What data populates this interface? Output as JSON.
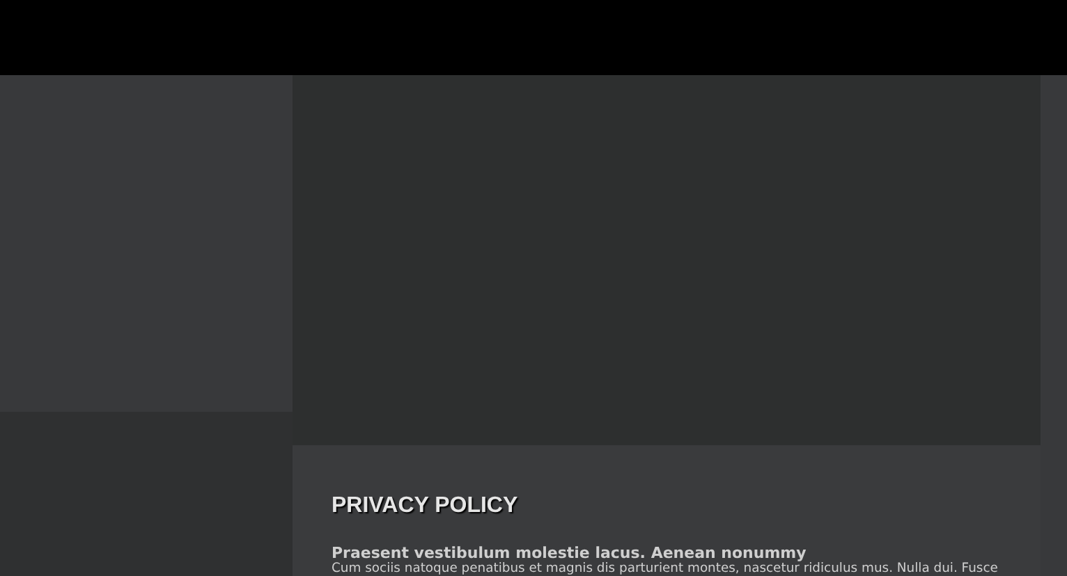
{
  "section": {
    "title": "PRIVACY POLICY",
    "subtitle": "Praesent vestibulum molestie lacus. Aenean nonummy",
    "paragraph": "Cum sociis natoque penatibus et magnis dis parturient montes, nascetur ridiculus mus. Nulla dui. Fusce"
  }
}
